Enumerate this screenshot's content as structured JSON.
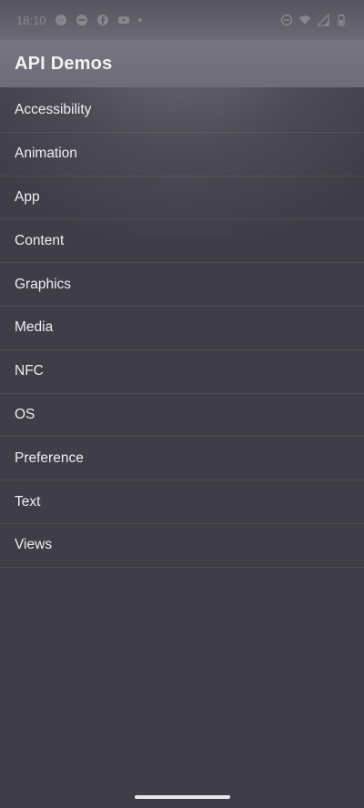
{
  "status_bar": {
    "time": "18:10",
    "left_icons": [
      "messenger-icon",
      "do-not-disturb-icon",
      "facebook-icon",
      "youtube-icon",
      "notification-dot-icon"
    ],
    "right_icons": [
      "do-not-disturb-icon",
      "wifi-icon",
      "signal-icon",
      "battery-icon"
    ]
  },
  "app_bar": {
    "title": "API Demos"
  },
  "list": {
    "items": [
      {
        "label": "Accessibility"
      },
      {
        "label": "Animation"
      },
      {
        "label": "App"
      },
      {
        "label": "Content"
      },
      {
        "label": "Graphics"
      },
      {
        "label": "Media"
      },
      {
        "label": "NFC"
      },
      {
        "label": "OS"
      },
      {
        "label": "Preference"
      },
      {
        "label": "Text"
      },
      {
        "label": "Views"
      }
    ]
  },
  "colors": {
    "background": "#3f3e48",
    "app_bar": "#6e6c78",
    "text": "#eeeef2"
  }
}
